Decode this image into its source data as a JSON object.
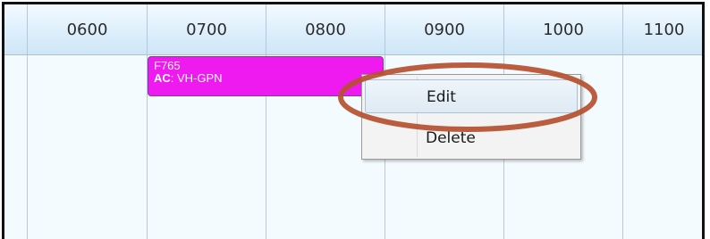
{
  "timeline": {
    "hours": [
      "0600",
      "0700",
      "0800",
      "0900",
      "1000",
      "1100"
    ]
  },
  "flight": {
    "number": "F765",
    "ac_key": "AC",
    "ac_value": ": VH-GPN",
    "color": "#ee1af0"
  },
  "context_menu": {
    "items": [
      {
        "label": "Edit",
        "highlighted": true
      },
      {
        "label": "Delete",
        "highlighted": false
      }
    ]
  },
  "annotation": {
    "ring_color": "#b5502f"
  }
}
